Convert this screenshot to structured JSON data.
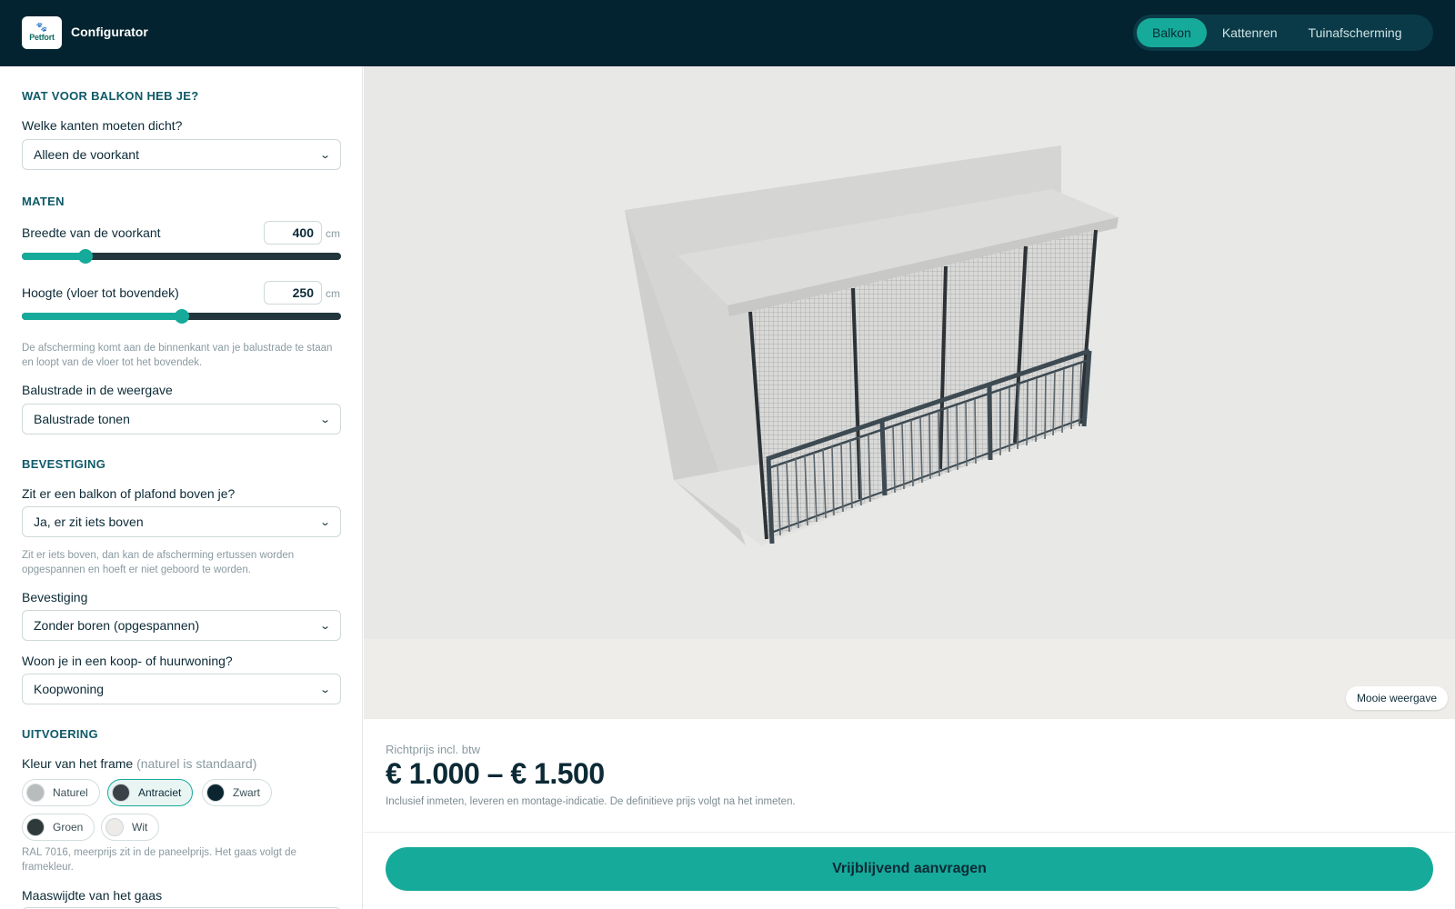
{
  "header": {
    "logo_text": "Petfort",
    "app_title": "Configurator",
    "tabs": [
      {
        "label": "Balkon",
        "active": true
      },
      {
        "label": "Kattenren",
        "active": false
      },
      {
        "label": "Tuinafscherming",
        "active": false
      }
    ]
  },
  "sidebar": {
    "section_balkon": {
      "title": "WAT VOOR BALKON HEB JE?",
      "sides_label": "Welke kanten moeten dicht?",
      "sides_value": "Alleen de voorkant"
    },
    "section_maten": {
      "title": "MATEN",
      "width_label": "Breedte van de voorkant",
      "width_value": "400",
      "width_unit": "cm",
      "width_slider_fraction": 0.2,
      "height_label": "Hoogte (vloer tot bovendek)",
      "height_value": "250",
      "height_unit": "cm",
      "height_slider_fraction": 0.5,
      "help": "De afscherming komt aan de binnenkant van je balustrade te staan en loopt van de vloer tot het bovendek.",
      "balustrade_label": "Balustrade in de weergave",
      "balustrade_value": "Balustrade tonen"
    },
    "section_bevestiging": {
      "title": "BEVESTIGING",
      "above_label": "Zit er een balkon of plafond boven je?",
      "above_value": "Ja, er zit iets boven",
      "help": "Zit er iets boven, dan kan de afscherming ertussen worden opgespannen en hoeft er niet geboord te worden.",
      "mount_label": "Bevestiging",
      "mount_value": "Zonder boren (opgespannen)",
      "home_label": "Woon je in een koop- of huurwoning?",
      "home_value": "Koopwoning"
    },
    "section_uitvoering": {
      "title": "UITVOERING",
      "color_label": "Kleur van het frame",
      "color_hint": "(naturel is standaard)",
      "colors": [
        {
          "label": "Naturel",
          "hex": "#b9bcbc",
          "selected": false
        },
        {
          "label": "Antraciet",
          "hex": "#3a4247",
          "selected": true
        },
        {
          "label": "Zwart",
          "hex": "#0a2430",
          "selected": false
        },
        {
          "label": "Groen",
          "hex": "#2e3a3a",
          "selected": false
        },
        {
          "label": "Wit",
          "hex": "#ecebe8",
          "selected": false
        }
      ],
      "color_help": "RAL 7016, meerprijs zit in de paneelprijs. Het gaas volgt de framekleur.",
      "mesh_label": "Maaswijdte van het gaas"
    }
  },
  "viewer": {
    "pretty_view_label": "Mooie weergave"
  },
  "price": {
    "label": "Richtprijs incl. btw",
    "value": "€ 1.000 – € 1.500",
    "note": "Inclusief inmeten, leveren en montage-indicatie. De definitieve prijs volgt na het inmeten."
  },
  "cta": {
    "label": "Vrijblijvend aanvragen"
  },
  "colors": {
    "accent": "#16aa9a",
    "header_bg": "#032330",
    "section_title": "#0f5a68"
  }
}
